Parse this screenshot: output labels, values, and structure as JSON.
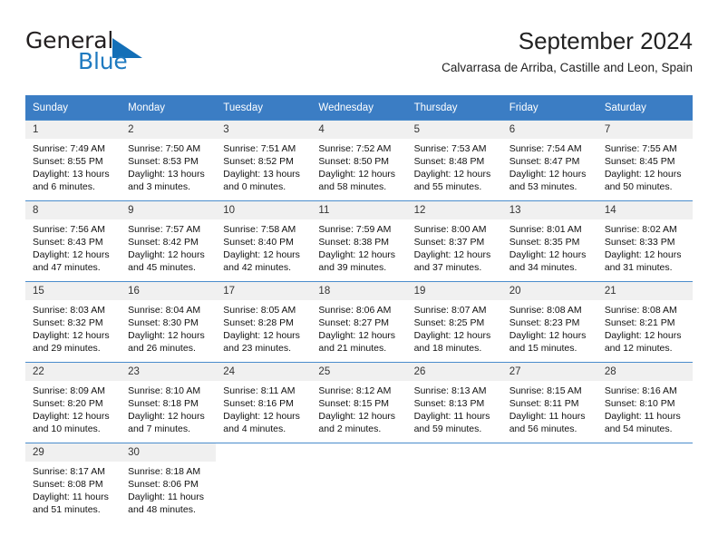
{
  "brand": {
    "name_part1": "General",
    "name_part2": "Blue",
    "logo_icon": "triangle-icon",
    "accent_color": "#1f7ac0"
  },
  "header": {
    "title": "September 2024",
    "subtitle": "Calvarrasa de Arriba, Castille and Leon, Spain"
  },
  "calendar": {
    "header_bg": "#3b7dc4",
    "daynum_bg": "#f0f0f0",
    "weekdays": [
      "Sunday",
      "Monday",
      "Tuesday",
      "Wednesday",
      "Thursday",
      "Friday",
      "Saturday"
    ],
    "weeks": [
      [
        {
          "day": "1",
          "sunrise": "Sunrise: 7:49 AM",
          "sunset": "Sunset: 8:55 PM",
          "daylight1": "Daylight: 13 hours",
          "daylight2": "and 6 minutes."
        },
        {
          "day": "2",
          "sunrise": "Sunrise: 7:50 AM",
          "sunset": "Sunset: 8:53 PM",
          "daylight1": "Daylight: 13 hours",
          "daylight2": "and 3 minutes."
        },
        {
          "day": "3",
          "sunrise": "Sunrise: 7:51 AM",
          "sunset": "Sunset: 8:52 PM",
          "daylight1": "Daylight: 13 hours",
          "daylight2": "and 0 minutes."
        },
        {
          "day": "4",
          "sunrise": "Sunrise: 7:52 AM",
          "sunset": "Sunset: 8:50 PM",
          "daylight1": "Daylight: 12 hours",
          "daylight2": "and 58 minutes."
        },
        {
          "day": "5",
          "sunrise": "Sunrise: 7:53 AM",
          "sunset": "Sunset: 8:48 PM",
          "daylight1": "Daylight: 12 hours",
          "daylight2": "and 55 minutes."
        },
        {
          "day": "6",
          "sunrise": "Sunrise: 7:54 AM",
          "sunset": "Sunset: 8:47 PM",
          "daylight1": "Daylight: 12 hours",
          "daylight2": "and 53 minutes."
        },
        {
          "day": "7",
          "sunrise": "Sunrise: 7:55 AM",
          "sunset": "Sunset: 8:45 PM",
          "daylight1": "Daylight: 12 hours",
          "daylight2": "and 50 minutes."
        }
      ],
      [
        {
          "day": "8",
          "sunrise": "Sunrise: 7:56 AM",
          "sunset": "Sunset: 8:43 PM",
          "daylight1": "Daylight: 12 hours",
          "daylight2": "and 47 minutes."
        },
        {
          "day": "9",
          "sunrise": "Sunrise: 7:57 AM",
          "sunset": "Sunset: 8:42 PM",
          "daylight1": "Daylight: 12 hours",
          "daylight2": "and 45 minutes."
        },
        {
          "day": "10",
          "sunrise": "Sunrise: 7:58 AM",
          "sunset": "Sunset: 8:40 PM",
          "daylight1": "Daylight: 12 hours",
          "daylight2": "and 42 minutes."
        },
        {
          "day": "11",
          "sunrise": "Sunrise: 7:59 AM",
          "sunset": "Sunset: 8:38 PM",
          "daylight1": "Daylight: 12 hours",
          "daylight2": "and 39 minutes."
        },
        {
          "day": "12",
          "sunrise": "Sunrise: 8:00 AM",
          "sunset": "Sunset: 8:37 PM",
          "daylight1": "Daylight: 12 hours",
          "daylight2": "and 37 minutes."
        },
        {
          "day": "13",
          "sunrise": "Sunrise: 8:01 AM",
          "sunset": "Sunset: 8:35 PM",
          "daylight1": "Daylight: 12 hours",
          "daylight2": "and 34 minutes."
        },
        {
          "day": "14",
          "sunrise": "Sunrise: 8:02 AM",
          "sunset": "Sunset: 8:33 PM",
          "daylight1": "Daylight: 12 hours",
          "daylight2": "and 31 minutes."
        }
      ],
      [
        {
          "day": "15",
          "sunrise": "Sunrise: 8:03 AM",
          "sunset": "Sunset: 8:32 PM",
          "daylight1": "Daylight: 12 hours",
          "daylight2": "and 29 minutes."
        },
        {
          "day": "16",
          "sunrise": "Sunrise: 8:04 AM",
          "sunset": "Sunset: 8:30 PM",
          "daylight1": "Daylight: 12 hours",
          "daylight2": "and 26 minutes."
        },
        {
          "day": "17",
          "sunrise": "Sunrise: 8:05 AM",
          "sunset": "Sunset: 8:28 PM",
          "daylight1": "Daylight: 12 hours",
          "daylight2": "and 23 minutes."
        },
        {
          "day": "18",
          "sunrise": "Sunrise: 8:06 AM",
          "sunset": "Sunset: 8:27 PM",
          "daylight1": "Daylight: 12 hours",
          "daylight2": "and 21 minutes."
        },
        {
          "day": "19",
          "sunrise": "Sunrise: 8:07 AM",
          "sunset": "Sunset: 8:25 PM",
          "daylight1": "Daylight: 12 hours",
          "daylight2": "and 18 minutes."
        },
        {
          "day": "20",
          "sunrise": "Sunrise: 8:08 AM",
          "sunset": "Sunset: 8:23 PM",
          "daylight1": "Daylight: 12 hours",
          "daylight2": "and 15 minutes."
        },
        {
          "day": "21",
          "sunrise": "Sunrise: 8:08 AM",
          "sunset": "Sunset: 8:21 PM",
          "daylight1": "Daylight: 12 hours",
          "daylight2": "and 12 minutes."
        }
      ],
      [
        {
          "day": "22",
          "sunrise": "Sunrise: 8:09 AM",
          "sunset": "Sunset: 8:20 PM",
          "daylight1": "Daylight: 12 hours",
          "daylight2": "and 10 minutes."
        },
        {
          "day": "23",
          "sunrise": "Sunrise: 8:10 AM",
          "sunset": "Sunset: 8:18 PM",
          "daylight1": "Daylight: 12 hours",
          "daylight2": "and 7 minutes."
        },
        {
          "day": "24",
          "sunrise": "Sunrise: 8:11 AM",
          "sunset": "Sunset: 8:16 PM",
          "daylight1": "Daylight: 12 hours",
          "daylight2": "and 4 minutes."
        },
        {
          "day": "25",
          "sunrise": "Sunrise: 8:12 AM",
          "sunset": "Sunset: 8:15 PM",
          "daylight1": "Daylight: 12 hours",
          "daylight2": "and 2 minutes."
        },
        {
          "day": "26",
          "sunrise": "Sunrise: 8:13 AM",
          "sunset": "Sunset: 8:13 PM",
          "daylight1": "Daylight: 11 hours",
          "daylight2": "and 59 minutes."
        },
        {
          "day": "27",
          "sunrise": "Sunrise: 8:15 AM",
          "sunset": "Sunset: 8:11 PM",
          "daylight1": "Daylight: 11 hours",
          "daylight2": "and 56 minutes."
        },
        {
          "day": "28",
          "sunrise": "Sunrise: 8:16 AM",
          "sunset": "Sunset: 8:10 PM",
          "daylight1": "Daylight: 11 hours",
          "daylight2": "and 54 minutes."
        }
      ],
      [
        {
          "day": "29",
          "sunrise": "Sunrise: 8:17 AM",
          "sunset": "Sunset: 8:08 PM",
          "daylight1": "Daylight: 11 hours",
          "daylight2": "and 51 minutes."
        },
        {
          "day": "30",
          "sunrise": "Sunrise: 8:18 AM",
          "sunset": "Sunset: 8:06 PM",
          "daylight1": "Daylight: 11 hours",
          "daylight2": "and 48 minutes."
        },
        {
          "day": "",
          "sunrise": "",
          "sunset": "",
          "daylight1": "",
          "daylight2": ""
        },
        {
          "day": "",
          "sunrise": "",
          "sunset": "",
          "daylight1": "",
          "daylight2": ""
        },
        {
          "day": "",
          "sunrise": "",
          "sunset": "",
          "daylight1": "",
          "daylight2": ""
        },
        {
          "day": "",
          "sunrise": "",
          "sunset": "",
          "daylight1": "",
          "daylight2": ""
        },
        {
          "day": "",
          "sunrise": "",
          "sunset": "",
          "daylight1": "",
          "daylight2": ""
        }
      ]
    ]
  }
}
